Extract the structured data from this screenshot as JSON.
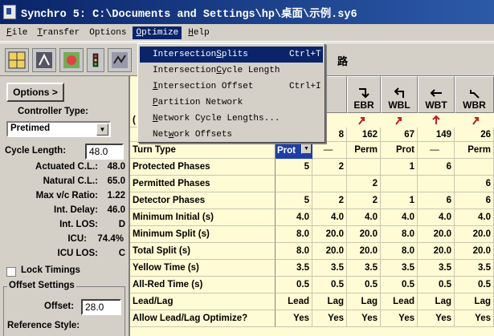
{
  "window": {
    "title": "Synchro 5: C:\\Documents and Settings\\hp\\桌面\\示例.sy6"
  },
  "menubar": {
    "items": [
      {
        "ul": "F",
        "rest": "ile"
      },
      {
        "ul": "T",
        "rest": "ransfer"
      },
      {
        "ul": "",
        "rest": "Options"
      },
      {
        "ul": "O",
        "rest": "ptimize"
      },
      {
        "ul": "H",
        "rest": "elp"
      }
    ]
  },
  "optimize_menu": {
    "items": [
      {
        "pre": "Intersection ",
        "ul": "S",
        "post": "plits",
        "shortcut": "Ctrl+T"
      },
      {
        "pre": "Intersection ",
        "ul": "C",
        "post": "ycle Length",
        "shortcut": ""
      },
      {
        "pre": "",
        "ul": "I",
        "post": "ntersection Offset",
        "shortcut": "Ctrl+I"
      },
      {
        "pre": "",
        "ul": "P",
        "post": "artition Network",
        "shortcut": ""
      },
      {
        "pre": "",
        "ul": "N",
        "post": "etwork Cycle Lengths...",
        "shortcut": ""
      },
      {
        "pre": "Net",
        "ul": "w",
        "post": "ork Offsets",
        "shortcut": ""
      }
    ]
  },
  "toolbar": {
    "visible_text": "路"
  },
  "left_panel": {
    "options_button": "Options >",
    "controller_type_label": "Controller Type:",
    "controller_type_value": "Pretimed",
    "cycle_length_label": "Cycle Length:",
    "cycle_length_value": "48.0",
    "rows": [
      {
        "label": "Actuated C.L.:",
        "value": "48.0"
      },
      {
        "label": "Natural C.L.:",
        "value": "65.0"
      },
      {
        "label": "Max v/c Ratio:",
        "value": "1.22"
      },
      {
        "label": "Int. Delay:",
        "value": "46.0"
      },
      {
        "label": "Int. LOS:",
        "value": "D"
      },
      {
        "label": "ICU:",
        "value": "74.4%"
      },
      {
        "label": "ICU LOS:",
        "value": "C"
      }
    ],
    "lock_timings_label": "Lock Timings",
    "offset_settings_label": "Offset Settings",
    "offset_label": "Offset:",
    "offset_value": "28.0",
    "reference_style_label": "Reference Style:"
  },
  "grid": {
    "columns": [
      "EBR",
      "WBL",
      "WBT",
      "WBR"
    ],
    "partial_row_label": "(",
    "volumes": [
      "8",
      "162",
      "67",
      "149",
      "26"
    ],
    "rows": [
      {
        "label": "Turn Type",
        "cells": [
          "Prot",
          "—",
          "Perm",
          "Prot",
          "—",
          "Perm"
        ]
      },
      {
        "label": "Protected Phases",
        "cells": [
          "5",
          "2",
          "",
          "1",
          "6",
          ""
        ]
      },
      {
        "label": "Permitted Phases",
        "cells": [
          "",
          "",
          "2",
          "",
          "",
          "6"
        ]
      },
      {
        "label": "Detector Phases",
        "cells": [
          "5",
          "2",
          "2",
          "1",
          "6",
          "6"
        ]
      },
      {
        "label": "Minimum Initial (s)",
        "cells": [
          "4.0",
          "4.0",
          "4.0",
          "4.0",
          "4.0",
          "4.0"
        ]
      },
      {
        "label": "Minimum Split (s)",
        "cells": [
          "8.0",
          "20.0",
          "20.0",
          "8.0",
          "20.0",
          "20.0"
        ]
      },
      {
        "label": "Total Split (s)",
        "cells": [
          "8.0",
          "20.0",
          "20.0",
          "8.0",
          "20.0",
          "20.0"
        ]
      },
      {
        "label": "Yellow Time (s)",
        "cells": [
          "3.5",
          "3.5",
          "3.5",
          "3.5",
          "3.5",
          "3.5"
        ]
      },
      {
        "label": "All-Red Time (s)",
        "cells": [
          "0.5",
          "0.5",
          "0.5",
          "0.5",
          "0.5",
          "0.5"
        ]
      },
      {
        "label": "Lead/Lag",
        "cells": [
          "Lead",
          "Lag",
          "Lag",
          "Lead",
          "Lag",
          "Lag"
        ]
      },
      {
        "label": "Allow Lead/Lag Optimize?",
        "cells": [
          "Yes",
          "Yes",
          "Yes",
          "Yes",
          "Yes",
          "Yes"
        ]
      }
    ]
  },
  "colors": {
    "title_bar": "#0a246a",
    "grid_background": "#fffbd4",
    "left_panel_background": "#d4d0c8",
    "menu_highlight": "#0a246a",
    "arrow_red": "#c02020"
  }
}
